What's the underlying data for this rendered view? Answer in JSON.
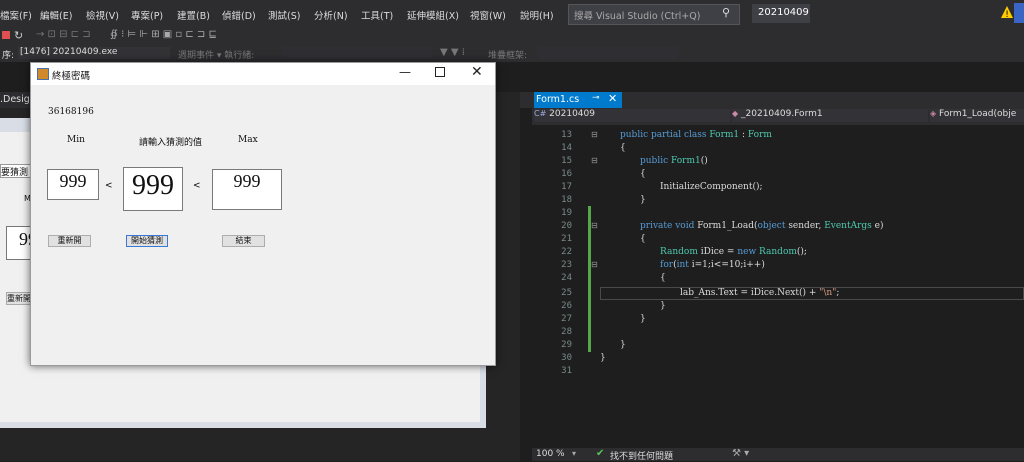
{
  "menu": {
    "items": [
      "檔案(F)",
      "編輯(E)",
      "檢視(V)",
      "專案(P)",
      "建置(B)",
      "偵錯(D)",
      "測試(S)",
      "分析(N)",
      "工具(T)",
      "延伸模組(X)",
      "視窗(W)",
      "說明(H)"
    ]
  },
  "search": {
    "placeholder": "搜尋 Visual Studio (Ctrl+Q)"
  },
  "solution_name": "20210409",
  "toolbar2": {
    "process_label": "序:",
    "process_value": "[1476] 20210409.exe",
    "lifecycle_label": "週期事件 ▾ 執行緒:",
    "stackframe_label": "堆疊框架:"
  },
  "design_tab": ".Design",
  "form_bg": {
    "partial_label": "要猜測",
    "partial_button": "重新開"
  },
  "form": {
    "title": "終極密碼",
    "answer_text": "36168196",
    "min_label": "Min",
    "prompt_label": "請輸入猜測的值",
    "max_label": "Max",
    "min_value": "999",
    "guess_value": "999",
    "max_value": "999",
    "lt1": "<",
    "lt2": "<",
    "reset_button": "重新開",
    "start_button": "開始猜測",
    "end_button": "結束"
  },
  "editor": {
    "tab_label": "Form1.cs",
    "nav_project": "20210409",
    "nav_class": "_20210409.Form1",
    "nav_member": "Form1_Load(obje",
    "line_numbers": [
      "13",
      "14",
      "15",
      "16",
      "17",
      "18",
      "19",
      "20",
      "21",
      "22",
      "23",
      "24",
      "25",
      "26",
      "27",
      "28",
      "29",
      "30",
      "31"
    ],
    "zoom": "100 %",
    "status_text": "找不到任何問題"
  },
  "colors": {
    "accent": "#007acc",
    "bg": "#1e1e1e",
    "keyword": "#569cd6",
    "type": "#4ec9b0",
    "string": "#d69d85"
  }
}
